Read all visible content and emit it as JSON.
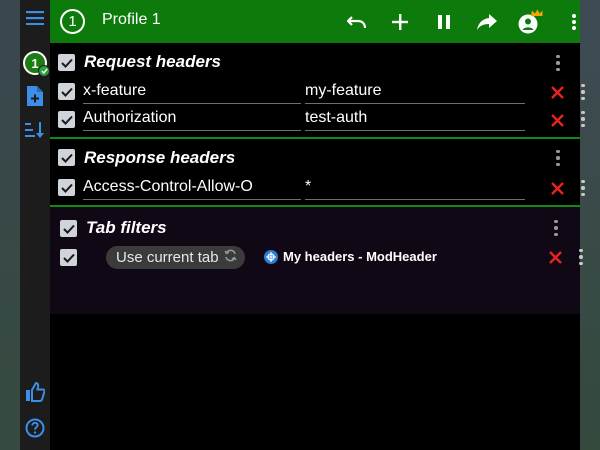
{
  "profile": {
    "number": "1",
    "name": "Profile 1"
  },
  "sidebar": {
    "menu_icon": "hamburger-menu-icon",
    "profile_badge": "1",
    "add_profile_icon": "add-file-icon",
    "sort_icon": "sort-icon",
    "like_icon": "thumbs-up-icon",
    "help_icon": "help-icon"
  },
  "toolbar": {
    "undo_icon": "undo-icon",
    "add_icon": "plus-icon",
    "pause_icon": "pause-icon",
    "share_icon": "share-arrow-icon",
    "account_icon": "account-crown-icon",
    "more_icon": "more-vert-icon"
  },
  "sections": {
    "request": {
      "title": "Request headers",
      "rows": [
        {
          "name": "x-feature",
          "value": "my-feature"
        },
        {
          "name": "Authorization",
          "value": "test-auth"
        }
      ]
    },
    "response": {
      "title": "Response headers",
      "rows": [
        {
          "name": "Access-Control-Allow-O",
          "value": "*"
        }
      ]
    },
    "tab_filters": {
      "title": "Tab filters",
      "button_label": "Use current tab",
      "tab_title": "My headers - ModHeader"
    }
  },
  "colors": {
    "header_green": "#0c7b0c",
    "divider_green": "#128a12",
    "delete_red": "#e8251c",
    "sidebar_blue": "#3d8ee8"
  }
}
